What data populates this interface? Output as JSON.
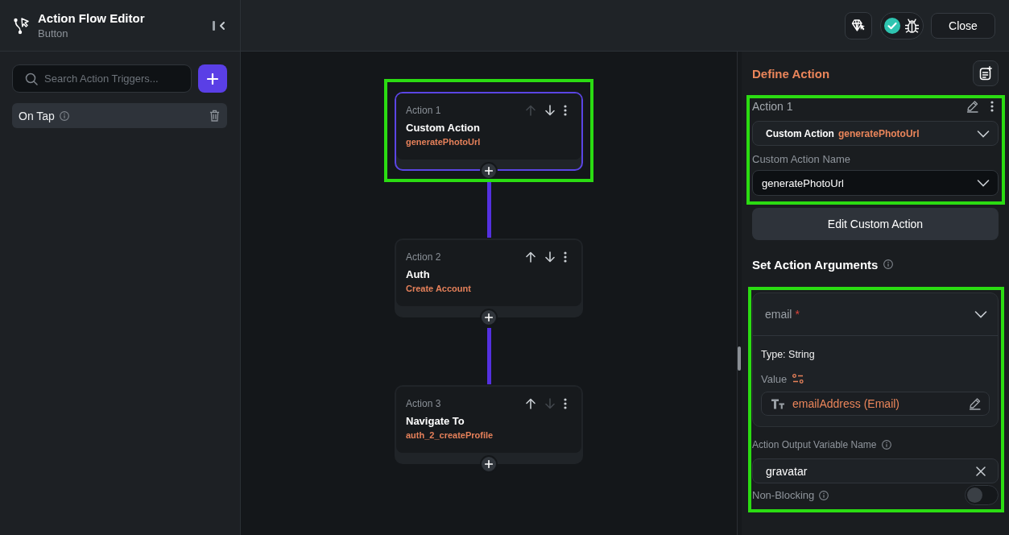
{
  "header": {
    "title": "Action Flow Editor",
    "subtitle": "Button"
  },
  "toolbar": {
    "status": {
      "checked": true
    },
    "close_button": "Close"
  },
  "triggers": {
    "search": {
      "placeholder": "Search Action Triggers..."
    },
    "items": [
      {
        "label": "On Tap",
        "selected": true
      }
    ]
  },
  "flow": {
    "actions": [
      {
        "label": "Action 1",
        "title": "Custom Action",
        "detail": "generatePhotoUrl",
        "selected": true,
        "highlighted": true,
        "can_move_up": false,
        "can_move_down": true
      },
      {
        "label": "Action 2",
        "title": "Auth",
        "detail": "Create Account",
        "selected": false,
        "highlighted": false,
        "can_move_up": true,
        "can_move_down": true
      },
      {
        "label": "Action 3",
        "title": "Navigate To",
        "detail": "auth_2_createProfile",
        "selected": false,
        "highlighted": false,
        "can_move_up": true,
        "can_move_down": false
      }
    ]
  },
  "panel": {
    "title": "Define Action",
    "action": {
      "label": "Action 1",
      "highlighted": true,
      "type_select": {
        "type": "Custom Action",
        "name": "generatePhotoUrl"
      },
      "name_field": {
        "label": "Custom Action Name",
        "value": "generatePhotoUrl"
      }
    },
    "edit_button": "Edit Custom Action",
    "arguments": {
      "title": "Set Action Arguments",
      "highlighted": true,
      "items": [
        {
          "name": "email",
          "required_mark": "*",
          "expanded": true,
          "type": "Type: String",
          "value_label": "Value",
          "value": "emailAddress (Email)"
        }
      ],
      "output": {
        "label": "Action Output Variable Name",
        "value": "gravatar"
      },
      "non_blocking": {
        "label": "Non-Blocking",
        "on": false
      }
    }
  }
}
